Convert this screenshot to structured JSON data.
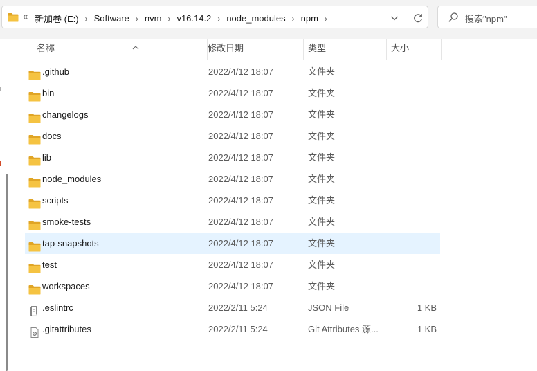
{
  "address_bar": {
    "overflow": "«",
    "crumbs": [
      "新加卷 (E:)",
      "Software",
      "nvm",
      "v16.14.2",
      "node_modules",
      "npm"
    ]
  },
  "search": {
    "placeholder": "搜索\"npm\""
  },
  "columns": {
    "name": "名称",
    "modified": "修改日期",
    "type": "类型",
    "size": "大小"
  },
  "files": [
    {
      "name": ".github",
      "modified": "2022/4/12 18:07",
      "type": "文件夹",
      "size": "",
      "icon": "folder-icon"
    },
    {
      "name": "bin",
      "modified": "2022/4/12 18:07",
      "type": "文件夹",
      "size": "",
      "icon": "folder-icon"
    },
    {
      "name": "changelogs",
      "modified": "2022/4/12 18:07",
      "type": "文件夹",
      "size": "",
      "icon": "folder-icon"
    },
    {
      "name": "docs",
      "modified": "2022/4/12 18:07",
      "type": "文件夹",
      "size": "",
      "icon": "folder-icon"
    },
    {
      "name": "lib",
      "modified": "2022/4/12 18:07",
      "type": "文件夹",
      "size": "",
      "icon": "folder-icon"
    },
    {
      "name": "node_modules",
      "modified": "2022/4/12 18:07",
      "type": "文件夹",
      "size": "",
      "icon": "folder-icon"
    },
    {
      "name": "scripts",
      "modified": "2022/4/12 18:07",
      "type": "文件夹",
      "size": "",
      "icon": "folder-icon"
    },
    {
      "name": "smoke-tests",
      "modified": "2022/4/12 18:07",
      "type": "文件夹",
      "size": "",
      "icon": "folder-icon"
    },
    {
      "name": "tap-snapshots",
      "modified": "2022/4/12 18:07",
      "type": "文件夹",
      "size": "",
      "icon": "folder-icon",
      "selected": true
    },
    {
      "name": "test",
      "modified": "2022/4/12 18:07",
      "type": "文件夹",
      "size": "",
      "icon": "folder-icon"
    },
    {
      "name": "workspaces",
      "modified": "2022/4/12 18:07",
      "type": "文件夹",
      "size": "",
      "icon": "folder-icon"
    },
    {
      "name": ".eslintrc",
      "modified": "2022/2/11 5:24",
      "type": "JSON File",
      "size": "1 KB",
      "icon": "json-file-icon"
    },
    {
      "name": ".gitattributes",
      "modified": "2022/2/11 5:24",
      "type": "Git Attributes 源...",
      "size": "1 KB",
      "icon": "gitattributes-file-icon"
    }
  ],
  "colors": {
    "selection": "#e5f3ff",
    "folder": "#f5c342",
    "folder_dark": "#e0a526"
  }
}
